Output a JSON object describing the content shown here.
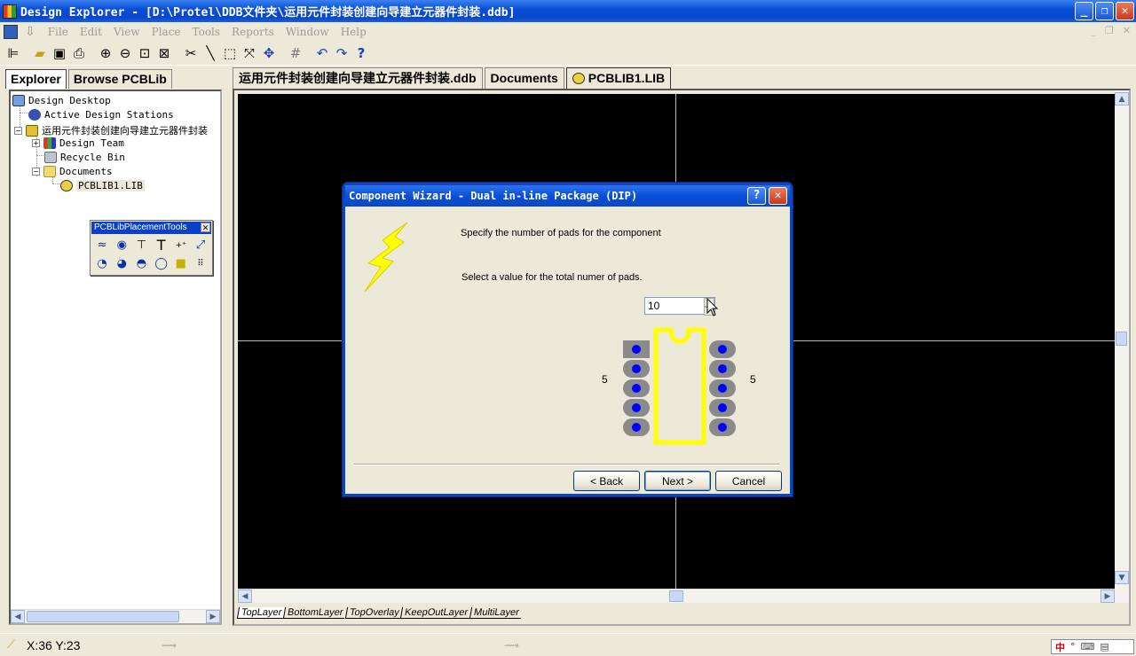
{
  "window": {
    "title": "Design Explorer - [D:\\Protel\\DDB文件夹\\运用元件封装创建向导建立元器件封装.ddb]",
    "minimize": "_",
    "maximize": "❐",
    "close": "✕"
  },
  "menu": [
    "File",
    "Edit",
    "View",
    "Place",
    "Tools",
    "Reports",
    "Window",
    "Help"
  ],
  "mdi_controls": [
    "_",
    "❐",
    "✕"
  ],
  "toolbar_icons": [
    "design-manager-icon",
    "open-icon",
    "save-icon",
    "print-icon",
    "zoom-in-icon",
    "zoom-out-icon",
    "zoom-fit-icon",
    "zoom-area-icon",
    "cut-icon",
    "line-icon",
    "select-icon",
    "deselect-icon",
    "move-icon",
    "grid-icon",
    "undo-icon",
    "redo-icon",
    "help-icon"
  ],
  "left_tabs": [
    "Explorer",
    "Browse PCBLib"
  ],
  "tree": {
    "root": "Design Desktop",
    "stations": "Active Design Stations",
    "db": "运用元件封装创建向导建立元器件封装",
    "team": "Design Team",
    "recycle": "Recycle Bin",
    "documents": "Documents",
    "lib": "PCBLIB1.LIB"
  },
  "placement_tools": {
    "title": "PCBLibPlacementTools",
    "close": "✕",
    "text_tool": "T"
  },
  "doc_tabs": [
    "运用元件封装创建向导建立元器件封装.ddb",
    "Documents",
    "PCBLIB1.LIB"
  ],
  "layers": [
    "TopLayer",
    "BottomLayer",
    "TopOverlay",
    "KeepOutLayer",
    "MultiLayer"
  ],
  "status": {
    "coords": "X:36 Y:23"
  },
  "ime": {
    "lang": "中"
  },
  "dialog": {
    "title": "Component Wizard - Dual in-line Package (DIP)",
    "help": "?",
    "close": "✕",
    "line1": "Specify the number of pads for the component",
    "line2": "Select a value for the total numer of pads.",
    "pad_count": "10",
    "left_count": "5",
    "right_count": "5",
    "back": "< Back",
    "next": "Next >",
    "cancel": "Cancel"
  },
  "colors": {
    "canvas": "#000000",
    "body_outline": "#ffff00",
    "pad": "#8a8a8a",
    "hole": "#0000ff",
    "titlebar": "#0a4fd8"
  }
}
